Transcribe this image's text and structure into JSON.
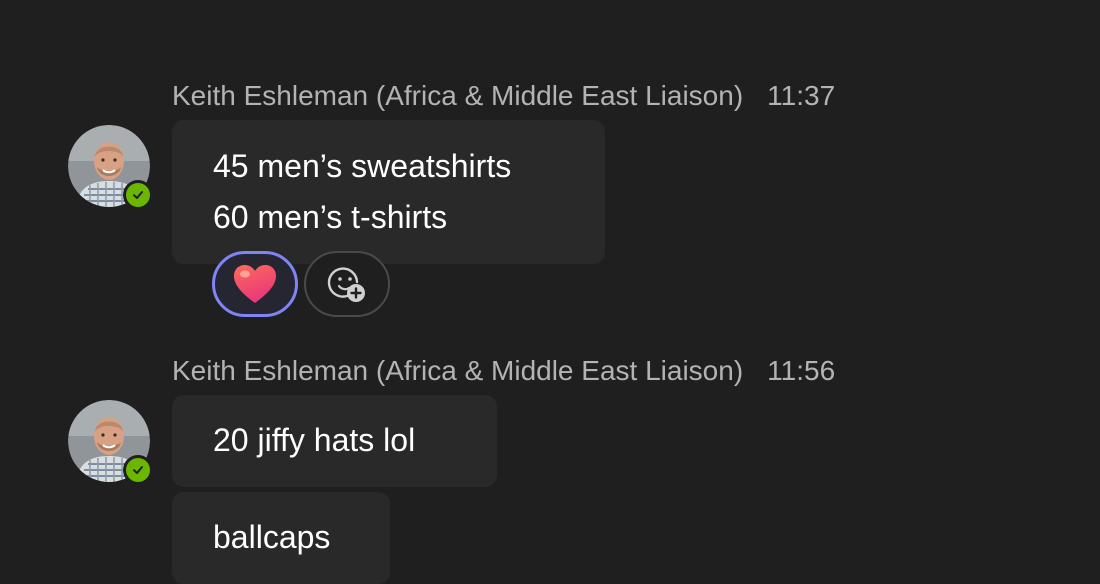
{
  "messages": [
    {
      "sender": "Keith Eshleman (Africa & Middle East Liaison)",
      "time": "11:37",
      "avatar_icon": "user-avatar",
      "presence": "available",
      "bubbles": [
        {
          "lines": [
            "45 men’s sweatshirts",
            "60 men’s t-shirts"
          ]
        }
      ],
      "reactions": [
        {
          "icon": "heart-emoji",
          "selected": true
        },
        {
          "icon": "add-reaction-icon",
          "selected": false
        }
      ]
    },
    {
      "sender": "Keith Eshleman (Africa & Middle East Liaison)",
      "time": "11:56",
      "avatar_icon": "user-avatar",
      "presence": "available",
      "bubbles": [
        {
          "lines": [
            "20 jiffy hats lol"
          ]
        },
        {
          "lines": [
            "ballcaps"
          ]
        }
      ]
    }
  ],
  "colors": {
    "background": "#1f1f1f",
    "bubble": "#292929",
    "meta_text": "#b3b3b3",
    "presence_available": "#6bb700",
    "reaction_selected_border": "#7f85f5"
  }
}
